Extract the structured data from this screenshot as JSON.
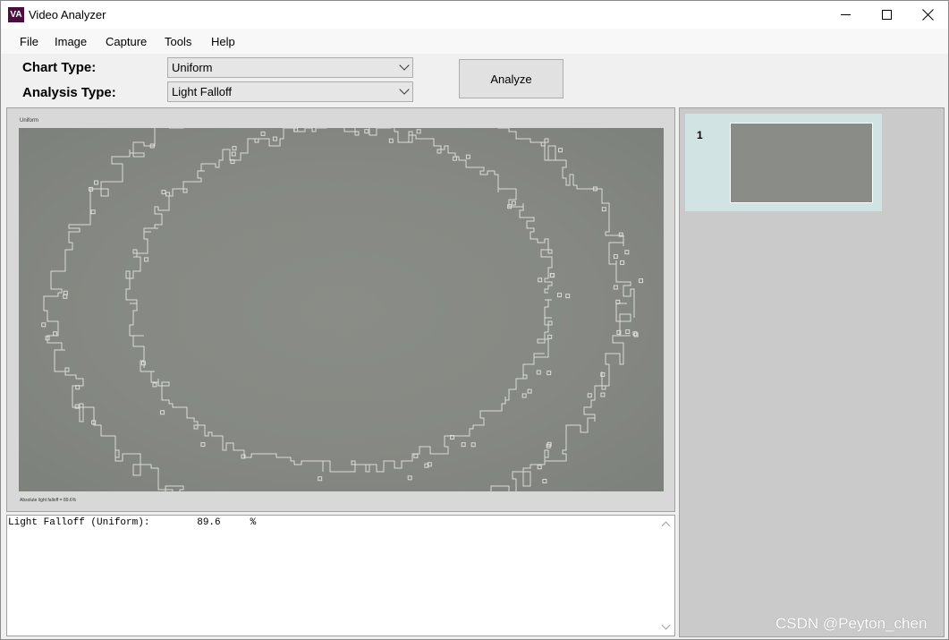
{
  "window": {
    "icon_text": "VA",
    "title": "Video Analyzer"
  },
  "menu": [
    "File",
    "Image",
    "Capture",
    "Tools",
    "Help"
  ],
  "controls": {
    "chart_type_label": "Chart Type:",
    "chart_type_value": "Uniform",
    "analysis_type_label": "Analysis Type:",
    "analysis_type_value": "Light Falloff",
    "analyze_label": "Analyze"
  },
  "image_panel": {
    "header": "Uniform",
    "footer": "Absolute light falloff = 89.6%"
  },
  "output": {
    "line": "Light Falloff (Uniform):        89.6     %"
  },
  "thumbnails": [
    {
      "number": "1"
    }
  ],
  "watermark": "CSDN @Peyton_chen",
  "colors": {
    "icon_bg": "#4a0f3e",
    "thumb_selected": "#d2e3e3",
    "image_gray": "#8a8d87"
  }
}
